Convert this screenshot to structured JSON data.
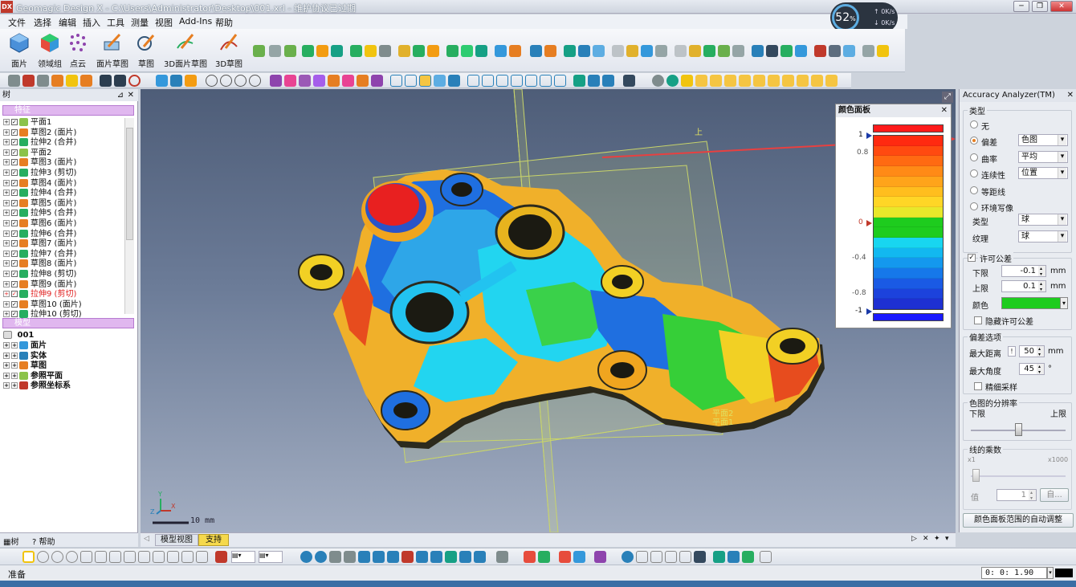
{
  "window": {
    "title": "Geomagic Design X - C:\\Users\\Administrator\\Desktop\\001.xrl - 维护协议已过期",
    "logo": "DX",
    "controls": [
      "minimize-icon",
      "restore-icon",
      "close-icon"
    ]
  },
  "menu": [
    "文件",
    "选择",
    "编辑",
    "插入",
    "工具",
    "测量",
    "视图",
    "Add-Ins",
    "帮助"
  ],
  "perf": {
    "percent": "52",
    "unit": "%",
    "up": "0K/s",
    "down": "0K/s"
  },
  "ribbon": [
    {
      "label": "面片",
      "icon": "mesh-icon"
    },
    {
      "label": "领域组",
      "icon": "region-group-icon"
    },
    {
      "label": "点云",
      "icon": "point-cloud-icon"
    },
    {
      "label": "面片草图",
      "icon": "mesh-sketch-icon"
    },
    {
      "label": "草图",
      "icon": "sketch-icon"
    },
    {
      "label": "3D面片草图",
      "icon": "3d-mesh-sketch-icon"
    },
    {
      "label": "3D草图",
      "icon": "3d-sketch-icon"
    }
  ],
  "tree": {
    "header": "树",
    "features_label": "特征",
    "features": [
      {
        "label": "平面1",
        "type": "plane"
      },
      {
        "label": "草图2 (面片)",
        "type": "sketch"
      },
      {
        "label": "拉伸2 (合并)",
        "type": "extrude"
      },
      {
        "label": "平面2",
        "type": "plane"
      },
      {
        "label": "草图3 (面片)",
        "type": "sketch"
      },
      {
        "label": "拉伸3 (剪切)",
        "type": "extrude"
      },
      {
        "label": "草图4 (面片)",
        "type": "sketch"
      },
      {
        "label": "拉伸4 (合并)",
        "type": "extrude"
      },
      {
        "label": "草图5 (面片)",
        "type": "sketch"
      },
      {
        "label": "拉伸5 (合并)",
        "type": "extrude"
      },
      {
        "label": "草图6 (面片)",
        "type": "sketch"
      },
      {
        "label": "拉伸6 (合并)",
        "type": "extrude"
      },
      {
        "label": "草图7 (面片)",
        "type": "sketch"
      },
      {
        "label": "拉伸7 (合并)",
        "type": "extrude"
      },
      {
        "label": "草图8 (面片)",
        "type": "sketch"
      },
      {
        "label": "拉伸8 (剪切)",
        "type": "extrude"
      },
      {
        "label": "草图9 (面片)",
        "type": "sketch"
      },
      {
        "label": "拉伸9 (剪切)",
        "type": "extrude",
        "color": "#e02020"
      },
      {
        "label": "草图10 (面片)",
        "type": "sketch"
      },
      {
        "label": "拉伸10 (剪切)",
        "type": "extrude"
      }
    ],
    "model_label": "模型",
    "model_root": "001",
    "model_items": [
      {
        "label": "面片",
        "type": "mesh"
      },
      {
        "label": "实体",
        "type": "solid"
      },
      {
        "label": "草图",
        "type": "sketch"
      },
      {
        "label": "参照平面",
        "type": "plane"
      },
      {
        "label": "参照坐标系",
        "type": "csys"
      }
    ],
    "dock_tabs": [
      "树",
      "帮助"
    ]
  },
  "viewport": {
    "up_label": "上",
    "plane_labels": [
      "平面2",
      "平面1"
    ],
    "scale_label": "10 mm",
    "axis_labels": {
      "x": "X",
      "y": "Y",
      "z": "Z"
    },
    "tabs": [
      "模型视图",
      "支持"
    ]
  },
  "color_panel": {
    "title": "颜色面板",
    "ticks": [
      "1",
      "0.8",
      "0",
      "-0.4",
      "-0.8",
      "-1"
    ],
    "colors": {
      "over": "#ff1a1a",
      "within": "#1ecc1e",
      "under": "#1a1aff"
    }
  },
  "accuracy": {
    "title": "Accuracy Analyzer(TM)",
    "type_group": "类型",
    "options": [
      {
        "label": "无",
        "selected": false
      },
      {
        "label": "偏差",
        "selected": true,
        "value": "色图"
      },
      {
        "label": "曲率",
        "selected": false,
        "value": "平均"
      },
      {
        "label": "连续性",
        "selected": false,
        "value": "位置"
      },
      {
        "label": "等距线",
        "selected": false
      },
      {
        "label": "环境写像",
        "selected": false
      }
    ],
    "sub_type_label": "类型",
    "sub_type_value": "球",
    "texture_label": "纹理",
    "texture_value": "球",
    "tolerance_label": "许可公差",
    "lower_label": "下限",
    "lower_value": "-0.1",
    "upper_label": "上限",
    "upper_value": "0.1",
    "unit": "mm",
    "color_label": "颜色",
    "tolerance_color": "#1ecc1e",
    "hide_tolerance_label": "隐藏许可公差",
    "deviation_group": "偏差选项",
    "max_distance_label": "最大距离",
    "max_distance_value": "50",
    "max_angle_label": "最大角度",
    "max_angle_value": "45",
    "angle_unit": "°",
    "fine_sampling_label": "精细采样",
    "resolution_group": "色图的分辨率",
    "res_lower": "下限",
    "res_upper": "上限",
    "multiplier_group": "线的乘数",
    "mult_min": "x1",
    "mult_max": "x1000",
    "value_label": "值",
    "value_value": "1",
    "auto_label": "自...",
    "auto_adjust_button": "颜色面板范围的自动调整"
  },
  "status": {
    "text": "准备",
    "time": "0: 0: 1.90"
  }
}
